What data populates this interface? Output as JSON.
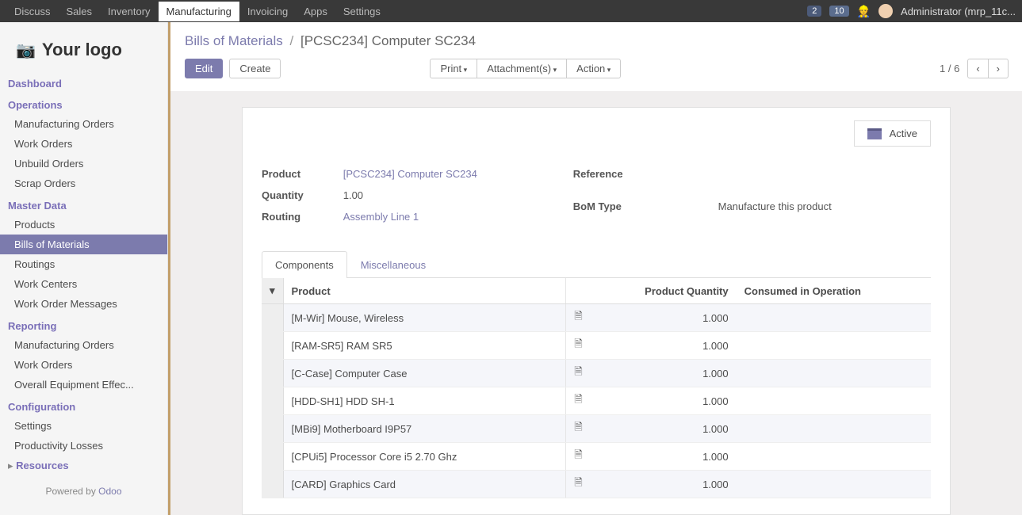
{
  "top_nav": {
    "items": [
      "Discuss",
      "Sales",
      "Inventory",
      "Manufacturing",
      "Invoicing",
      "Apps",
      "Settings"
    ],
    "active": "Manufacturing",
    "badge1": "2",
    "badge2": "10",
    "user": "Administrator (mrp_11c..."
  },
  "logo": "Your logo",
  "sidebar": {
    "sections": [
      {
        "header": "Dashboard",
        "items": []
      },
      {
        "header": "Operations",
        "items": [
          "Manufacturing Orders",
          "Work Orders",
          "Unbuild Orders",
          "Scrap Orders"
        ]
      },
      {
        "header": "Master Data",
        "items": [
          "Products",
          "Bills of Materials",
          "Routings",
          "Work Centers",
          "Work Order Messages"
        ]
      },
      {
        "header": "Reporting",
        "items": [
          "Manufacturing Orders",
          "Work Orders",
          "Overall Equipment Effec..."
        ]
      },
      {
        "header": "Configuration",
        "items": [
          "Settings",
          "Productivity Losses"
        ]
      }
    ],
    "active_item": "Bills of Materials",
    "resources": "Resources",
    "powered_pre": "Powered by ",
    "powered_link": "Odoo"
  },
  "breadcrumb": {
    "root": "Bills of Materials",
    "current": "[PCSC234] Computer SC234"
  },
  "actions": {
    "edit": "Edit",
    "create": "Create",
    "print": "Print",
    "attachments": "Attachment(s)",
    "action": "Action"
  },
  "pager": {
    "text": "1 / 6",
    "prev": "‹",
    "next": "›"
  },
  "status": {
    "label": "Active"
  },
  "form": {
    "product_label": "Product",
    "product_value": "[PCSC234] Computer SC234",
    "quantity_label": "Quantity",
    "quantity_value": "1.00",
    "routing_label": "Routing",
    "routing_value": "Assembly Line 1",
    "reference_label": "Reference",
    "bom_type_label": "BoM Type",
    "bom_type_value": "Manufacture this product"
  },
  "tabs": {
    "components": "Components",
    "misc": "Miscellaneous"
  },
  "table": {
    "headers": {
      "product": "Product",
      "qty": "Product Quantity",
      "consumed": "Consumed in Operation"
    },
    "rows": [
      {
        "product": "[M-Wir] Mouse, Wireless",
        "qty": "1.000"
      },
      {
        "product": "[RAM-SR5] RAM SR5",
        "qty": "1.000"
      },
      {
        "product": "[C-Case] Computer Case",
        "qty": "1.000"
      },
      {
        "product": "[HDD-SH1] HDD SH-1",
        "qty": "1.000"
      },
      {
        "product": "[MBi9] Motherboard I9P57",
        "qty": "1.000"
      },
      {
        "product": "[CPUi5] Processor Core i5 2.70 Ghz",
        "qty": "1.000"
      },
      {
        "product": "[CARD] Graphics Card",
        "qty": "1.000"
      }
    ]
  }
}
